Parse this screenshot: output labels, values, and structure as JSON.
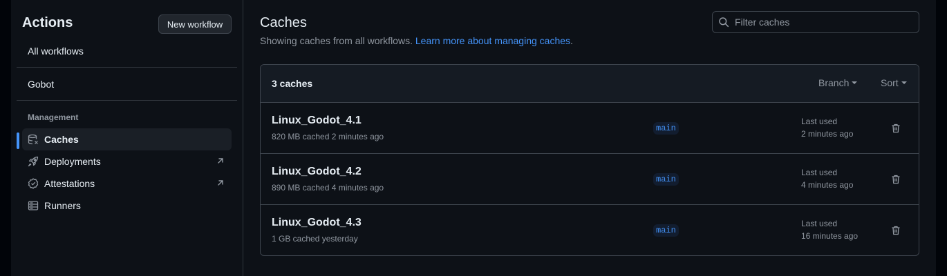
{
  "sidebar": {
    "title": "Actions",
    "new_workflow_label": "New workflow",
    "all_workflows_label": "All workflows",
    "workflow_label": "Gobot",
    "management_heading": "Management",
    "items": [
      {
        "label": "Caches",
        "icon": "database-icon",
        "active": true
      },
      {
        "label": "Deployments",
        "icon": "rocket-icon",
        "external": true
      },
      {
        "label": "Attestations",
        "icon": "verified-icon",
        "external": true
      },
      {
        "label": "Runners",
        "icon": "server-icon"
      }
    ]
  },
  "main": {
    "title": "Caches",
    "description": "Showing caches from all workflows.",
    "learn_more_link": "Learn more about managing caches",
    "description_end": ".",
    "filter_placeholder": "Filter caches",
    "count_label": "3 caches",
    "branch_menu_label": "Branch",
    "sort_menu_label": "Sort",
    "caches": [
      {
        "name": "Linux_Godot_4.1",
        "meta": "820 MB cached 2 minutes ago",
        "branch": "main",
        "last_used_label": "Last used",
        "last_used": "2 minutes ago"
      },
      {
        "name": "Linux_Godot_4.2",
        "meta": "890 MB cached 4 minutes ago",
        "branch": "main",
        "last_used_label": "Last used",
        "last_used": "4 minutes ago"
      },
      {
        "name": "Linux_Godot_4.3",
        "meta": "1 GB cached yesterday",
        "branch": "main",
        "last_used_label": "Last used",
        "last_used": "16 minutes ago"
      }
    ]
  },
  "colors": {
    "background": "#0d1117",
    "accent": "#4493f8",
    "border": "#3d444d",
    "muted_text": "#9198a1"
  }
}
